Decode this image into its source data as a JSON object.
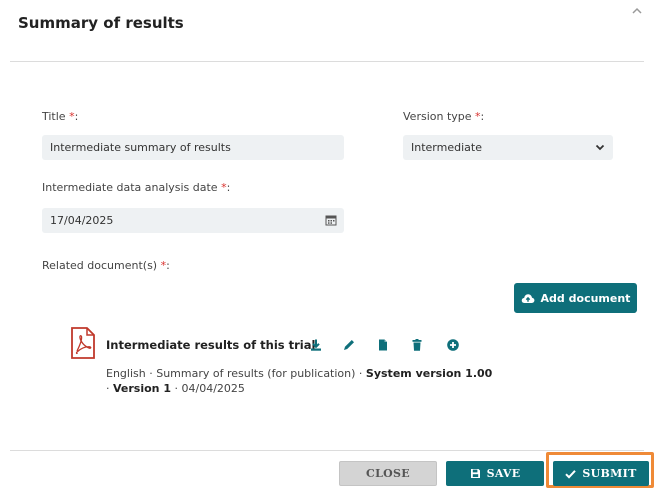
{
  "header": {
    "title": "Summary of results"
  },
  "form": {
    "required_mark": "*",
    "title": {
      "label": "Title",
      "value": "Intermediate summary of results"
    },
    "version_type": {
      "label": "Version type",
      "value": "Intermediate"
    },
    "analysis_date": {
      "label": "Intermediate data analysis date",
      "value": "17/04/2025"
    },
    "related_docs": {
      "label": "Related document(s)"
    },
    "add_document_label": "Add document"
  },
  "document": {
    "title": "Intermediate results of this trial",
    "meta_prefix": "English · Summary of results (for publication) · ",
    "system_version": "System version 1.00",
    "meta_sep": "· ",
    "version": "Version 1",
    "meta_date": " · 04/04/2025",
    "actions": [
      "download-icon",
      "edit-icon",
      "file-icon",
      "delete-icon",
      "add-icon"
    ]
  },
  "footer": {
    "close_label": "CLOSE",
    "save_label": "SAVE",
    "submit_label": "SUBMIT"
  },
  "colors": {
    "accent": "#0e6f7a",
    "required": "#d9322f",
    "highlight": "#ef8a37",
    "pdf": "#c0392b"
  }
}
